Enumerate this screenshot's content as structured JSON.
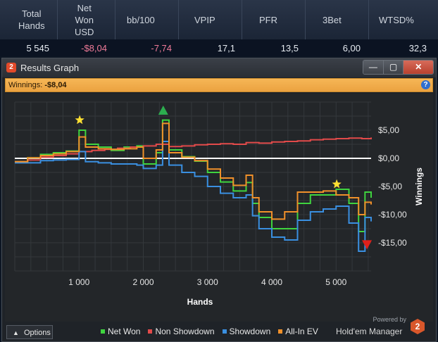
{
  "stats_table": {
    "headers": [
      "Total\nHands",
      "Net\nWon\nUSD",
      "bb/100",
      "VPIP",
      "PFR",
      "3Bet",
      "WTSD%"
    ],
    "values": [
      "5 545",
      "-$8,04",
      "-7,74",
      "17,1",
      "13,5",
      "6,00",
      "32,3"
    ]
  },
  "window": {
    "title": "Results Graph",
    "icon_label": "2",
    "buttons": {
      "minimize": "—",
      "maximize": "▢",
      "close": "✕"
    },
    "winnings_label": "Winnings:",
    "winnings_value": "-$8,04",
    "help": "?"
  },
  "chart_data": {
    "type": "line",
    "xlabel": "Hands",
    "ylabel": "Winnings",
    "xlim": [
      0,
      5545
    ],
    "ylim": [
      -20,
      10
    ],
    "x_ticks": [
      1000,
      2000,
      3000,
      4000,
      5000
    ],
    "x_tick_labels": [
      "1 000",
      "2 000",
      "3 000",
      "4 000",
      "5 000"
    ],
    "y_ticks": [
      5,
      0,
      -5,
      -10,
      -15
    ],
    "y_tick_labels": [
      "$5,00",
      "$0,00",
      "-$5,00",
      "-$10,00",
      "-$15,00"
    ],
    "grid": true,
    "legend_position": "bottom",
    "colors": {
      "net_won": "#3fd43f",
      "non_showdown": "#e24a4a",
      "showdown": "#3a8fe0",
      "all_in_ev": "#f0902a"
    },
    "series": [
      {
        "name": "Net Won",
        "color": "#3fd43f",
        "x": [
          0,
          200,
          400,
          600,
          800,
          1000,
          1100,
          1300,
          1500,
          1700,
          1900,
          2000,
          2200,
          2300,
          2400,
          2600,
          2800,
          3000,
          3200,
          3400,
          3600,
          3700,
          3800,
          4000,
          4200,
          4400,
          4600,
          4800,
          5000,
          5200,
          5350,
          5450,
          5545
        ],
        "y": [
          -0.6,
          0.1,
          0.7,
          1.0,
          1.3,
          5.0,
          2.5,
          2.0,
          1.4,
          2.0,
          2.2,
          -1.0,
          1.0,
          6.8,
          1.5,
          0.3,
          -0.5,
          -2.5,
          -4.2,
          -5.8,
          -4.3,
          -8.0,
          -10.5,
          -12.5,
          -12.5,
          -8.0,
          -6.5,
          -6.5,
          -5.5,
          -8.0,
          -13.0,
          -6.0,
          -7.0
        ]
      },
      {
        "name": "Non Showdown",
        "color": "#e24a4a",
        "x": [
          0,
          200,
          400,
          600,
          800,
          1000,
          1200,
          1400,
          1600,
          1800,
          2000,
          2200,
          2400,
          2600,
          2800,
          3000,
          3200,
          3400,
          3600,
          3800,
          4000,
          4200,
          4400,
          4600,
          4800,
          5000,
          5200,
          5400,
          5545
        ],
        "y": [
          -0.6,
          -0.3,
          0.2,
          0.5,
          0.8,
          1.2,
          1.4,
          1.6,
          1.8,
          2.0,
          2.2,
          2.5,
          2.1,
          2.2,
          2.4,
          2.5,
          2.6,
          2.5,
          2.8,
          2.7,
          2.9,
          3.0,
          3.1,
          3.3,
          3.4,
          3.5,
          3.6,
          3.5,
          3.7
        ]
      },
      {
        "name": "Showdown",
        "color": "#3a8fe0",
        "x": [
          0,
          200,
          400,
          600,
          800,
          1000,
          1100,
          1300,
          1500,
          1700,
          1900,
          2000,
          2200,
          2300,
          2400,
          2600,
          2800,
          3000,
          3200,
          3400,
          3600,
          3700,
          3800,
          4000,
          4200,
          4400,
          4600,
          4800,
          5000,
          5200,
          5350,
          5450,
          5545
        ],
        "y": [
          -0.8,
          -0.8,
          -0.4,
          -0.3,
          -0.2,
          1.2,
          -0.6,
          -0.8,
          -1.0,
          -1.0,
          -1.2,
          -1.8,
          -1.2,
          3.0,
          -1.2,
          -2.5,
          -3.2,
          -5.0,
          -6.2,
          -7.0,
          -6.5,
          -10.2,
          -12.5,
          -14.0,
          -14.5,
          -11.0,
          -9.5,
          -9.0,
          -8.5,
          -11.5,
          -16.5,
          -10.5,
          -11.2
        ]
      },
      {
        "name": "All-In EV",
        "color": "#f0902a",
        "x": [
          0,
          200,
          400,
          600,
          800,
          1000,
          1100,
          1300,
          1500,
          1700,
          1900,
          2000,
          2200,
          2300,
          2400,
          2600,
          2800,
          3000,
          3200,
          3400,
          3600,
          3700,
          3800,
          4000,
          4200,
          4400,
          4600,
          4800,
          5000,
          5200,
          5350,
          5450,
          5545
        ],
        "y": [
          -0.6,
          0.1,
          0.5,
          0.8,
          1.2,
          3.8,
          2.0,
          1.7,
          1.6,
          1.7,
          2.0,
          0.0,
          1.5,
          6.2,
          1.0,
          0.2,
          -0.4,
          -1.9,
          -3.5,
          -4.8,
          -3.0,
          -7.0,
          -9.5,
          -10.8,
          -9.5,
          -6.0,
          -6.0,
          -5.8,
          -6.5,
          -7.0,
          -10.0,
          -7.8,
          -8.2
        ]
      }
    ],
    "markers": [
      {
        "kind": "star",
        "x": 1010,
        "y": 6.8,
        "color": "#ffe033"
      },
      {
        "kind": "triangle-up",
        "x": 2310,
        "y": 8.5,
        "color": "#2cae4e"
      },
      {
        "kind": "star",
        "x": 5010,
        "y": -4.6,
        "color": "#ffe033"
      },
      {
        "kind": "triangle-down",
        "x": 5480,
        "y": -15.3,
        "color": "#e0201a"
      }
    ]
  },
  "footer": {
    "options_label": "Options",
    "options_icon": "chevron-up-icon",
    "legend": [
      {
        "label": "Net Won",
        "color": "#3fd43f"
      },
      {
        "label": "Non Showdown",
        "color": "#e24a4a"
      },
      {
        "label": "Showdown",
        "color": "#3a8fe0"
      },
      {
        "label": "All-In EV",
        "color": "#f0902a"
      }
    ],
    "powered_by": "Powered by",
    "brand": "Hold'em Manager",
    "brand_logo": "2"
  }
}
